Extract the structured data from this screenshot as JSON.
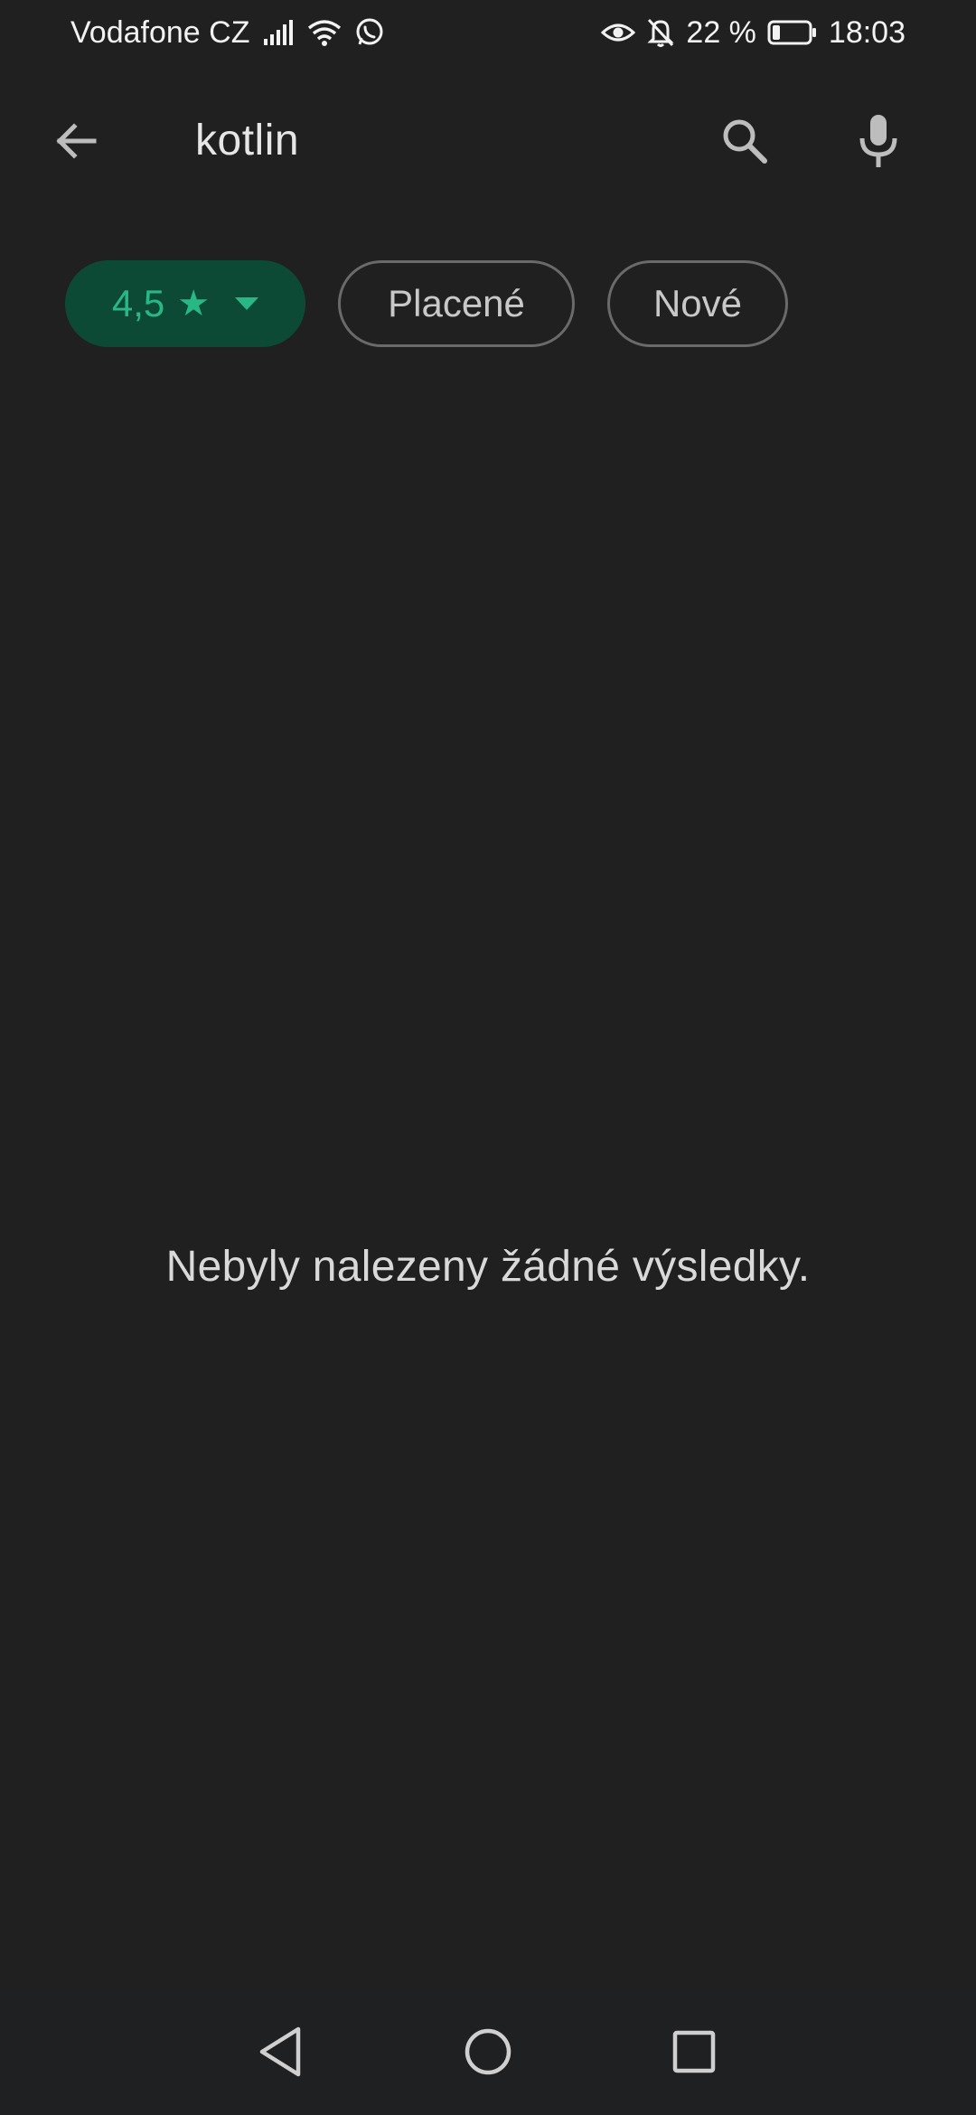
{
  "status_bar": {
    "carrier": "Vodafone CZ",
    "battery_percent": "22 %",
    "battery_level": 0.22,
    "time": "18:03",
    "icons": [
      "signal-icon",
      "wifi-icon",
      "whatsapp-icon",
      "eye-icon",
      "bell-off-icon",
      "battery-icon"
    ]
  },
  "search": {
    "query": "kotlin",
    "icons": [
      "back-arrow-icon",
      "search-icon",
      "microphone-icon"
    ]
  },
  "filters": {
    "rating_label": "4,5",
    "rating_star": "★",
    "paid_label": "Placené",
    "new_label": "Nové"
  },
  "results": {
    "empty_message": "Nebyly nalezeny žádné výsledky."
  },
  "nav": {
    "icons": [
      "nav-back-icon",
      "nav-home-icon",
      "nav-recents-icon"
    ]
  },
  "colors": {
    "background": "#202020",
    "chip_active_bg": "#0d4a36",
    "chip_active_fg": "#27b886",
    "chip_outline": "#6a6a6a"
  }
}
